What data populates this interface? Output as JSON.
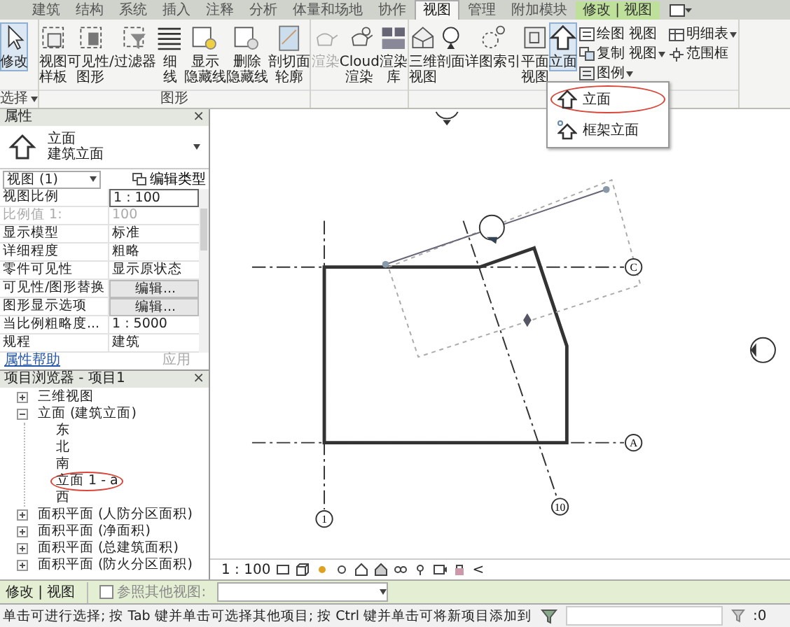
{
  "ribbon_tabs": [
    {
      "label": "建筑",
      "selected": false,
      "kind": "normal"
    },
    {
      "label": "结构",
      "selected": false,
      "kind": "normal"
    },
    {
      "label": "系统",
      "selected": false,
      "kind": "normal"
    },
    {
      "label": "插入",
      "selected": false,
      "kind": "normal"
    },
    {
      "label": "注释",
      "selected": false,
      "kind": "normal"
    },
    {
      "label": "分析",
      "selected": false,
      "kind": "normal"
    },
    {
      "label": "体量和场地",
      "selected": false,
      "kind": "normal"
    },
    {
      "label": "协作",
      "selected": false,
      "kind": "normal"
    },
    {
      "label": "视图",
      "selected": true,
      "kind": "normal"
    },
    {
      "label": "管理",
      "selected": false,
      "kind": "normal"
    },
    {
      "label": "附加模块",
      "selected": false,
      "kind": "normal"
    },
    {
      "label": "修改 | 视图",
      "selected": false,
      "kind": "contextual"
    }
  ],
  "ribbon": {
    "panels": [
      {
        "label": "选择",
        "menu": true,
        "buttons": [
          {
            "label": "修改",
            "pressed": true,
            "disabled": false
          }
        ]
      },
      {
        "label": "图形",
        "buttons": [
          {
            "label": "视图样板",
            "pressed": false,
            "disabled": false
          },
          {
            "label": "可见性/图形",
            "pressed": false,
            "disabled": false
          },
          {
            "label": "过滤器",
            "pressed": false,
            "disabled": false
          },
          {
            "label": "细线",
            "pressed": false,
            "disabled": false
          },
          {
            "label": "显示隐藏线",
            "pressed": false,
            "disabled": false
          },
          {
            "label": "删除隐藏线",
            "pressed": false,
            "disabled": false
          },
          {
            "label": "剖切面轮廓",
            "pressed": false,
            "disabled": false
          }
        ]
      },
      {
        "buttons": [
          {
            "label": "渲染",
            "pressed": false,
            "disabled": true
          },
          {
            "label": "Cloud 渲染",
            "pressed": false,
            "disabled": false
          },
          {
            "label": "渲染库",
            "pressed": false,
            "disabled": false
          }
        ]
      },
      {
        "buttons": [
          {
            "label": "三维视图",
            "pressed": false,
            "disabled": false
          },
          {
            "label": "剖面",
            "pressed": false,
            "disabled": false
          },
          {
            "label": "详图索引",
            "pressed": false,
            "disabled": false
          },
          {
            "label": "平面视图",
            "pressed": false,
            "disabled": false
          },
          {
            "label": "立面",
            "pressed": true,
            "disabled": false
          }
        ],
        "small_buttons": [
          {
            "label": "绘图 视图",
            "menu": false
          },
          {
            "label": "复制 视图",
            "menu": true
          },
          {
            "label": "图例",
            "menu": true
          },
          {
            "label": "明细表",
            "menu": true
          },
          {
            "label": "范围框",
            "menu": false
          }
        ]
      }
    ]
  },
  "elevation_menu": {
    "items": [
      {
        "label": "立面",
        "circled": true
      },
      {
        "label": "框架立面",
        "circled": false
      }
    ]
  },
  "properties": {
    "title": "属性",
    "close": "×",
    "type": {
      "name": "立面",
      "family": "建筑立面"
    },
    "filter": "视图 (1)",
    "edit_type": "编辑类型",
    "rows": [
      {
        "label": "视图比例",
        "value": "1 : 100",
        "kind": "field",
        "disabled": false
      },
      {
        "label": "比例值 1:",
        "value": "100",
        "kind": "text",
        "disabled": true
      },
      {
        "label": "显示模型",
        "value": "标准",
        "kind": "text",
        "disabled": false
      },
      {
        "label": "详细程度",
        "value": "粗略",
        "kind": "text",
        "disabled": false
      },
      {
        "label": "零件可见性",
        "value": "显示原状态",
        "kind": "text",
        "disabled": false
      },
      {
        "label": "可见性/图形替换",
        "value": "编辑...",
        "kind": "button",
        "disabled": false
      },
      {
        "label": "图形显示选项",
        "value": "编辑...",
        "kind": "button",
        "disabled": false
      },
      {
        "label": "当比例粗略度...",
        "value": "1 : 5000",
        "kind": "text",
        "disabled": false
      },
      {
        "label": "规程",
        "value": "建筑",
        "kind": "text",
        "disabled": false
      }
    ],
    "help": "属性帮助",
    "apply": {
      "label": "应用",
      "disabled": true
    }
  },
  "project_browser": {
    "title": "项目浏览器 - 项目1",
    "close": "×",
    "tree": [
      {
        "label": "三维视图",
        "expanded": false,
        "circled": false
      },
      {
        "label": "立面 (建筑立面)",
        "expanded": true,
        "circled": false,
        "children": [
          {
            "label": "东",
            "circled": false
          },
          {
            "label": "北",
            "circled": false
          },
          {
            "label": "南",
            "circled": false
          },
          {
            "label": "立面 1 - a",
            "circled": true
          },
          {
            "label": "西",
            "circled": false
          }
        ]
      },
      {
        "label": "面积平面 (人防分区面积)",
        "expanded": false,
        "circled": false
      },
      {
        "label": "面积平面 (净面积)",
        "expanded": false,
        "circled": false
      },
      {
        "label": "面积平面 (总建筑面积)",
        "expanded": false,
        "circled": false
      },
      {
        "label": "面积平面 (防火分区面积)",
        "expanded": false,
        "circled": false
      }
    ]
  },
  "canvas": {
    "grid_labels": [
      "C",
      "A",
      "1",
      "10"
    ],
    "view_bar": {
      "scale": "1 : 100",
      "collapse": "<"
    }
  },
  "options_bar": {
    "context": "修改 | 视图",
    "reference": {
      "label": "参照其他视图:",
      "checked": false
    }
  },
  "status_bar": {
    "text": "单击可进行选择; 按 Tab 键并单击可选择其他项目; 按 Ctrl 键并单击可将新项目添加到",
    "count": ":0"
  }
}
